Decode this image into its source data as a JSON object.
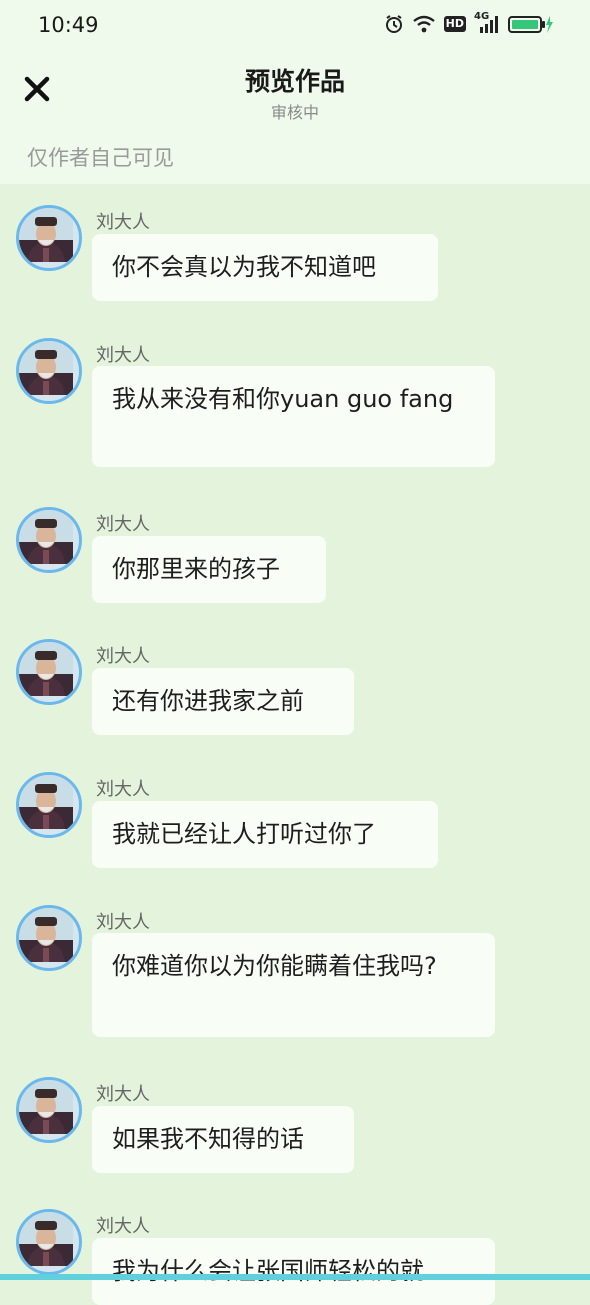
{
  "status_bar": {
    "time": "10:49",
    "network": "4G",
    "hd": "HD"
  },
  "header": {
    "title": "预览作品",
    "subtitle": "审核中",
    "visibility_note": "仅作者自己可见"
  },
  "messages": [
    {
      "sender": "刘大人",
      "text": "你不会真以为我不知道吧"
    },
    {
      "sender": "刘大人",
      "text": "我从来没有和你yuan guo fang"
    },
    {
      "sender": "刘大人",
      "text": "你那里来的孩子"
    },
    {
      "sender": "刘大人",
      "text": "还有你进我家之前"
    },
    {
      "sender": "刘大人",
      "text": "我就已经让人打听过你了"
    },
    {
      "sender": "刘大人",
      "text": "你难道你以为你能瞒着住我吗?"
    },
    {
      "sender": "刘大人",
      "text": "如果我不知得的话"
    },
    {
      "sender": "刘大人",
      "text": "我为什么会让张国师轻松的就"
    }
  ],
  "colors": {
    "background": "#e3f3dc",
    "header": "#effaec",
    "bubble": "#f8fdf6",
    "avatar_border": "#6bb8ec",
    "battery": "#34c77b"
  }
}
